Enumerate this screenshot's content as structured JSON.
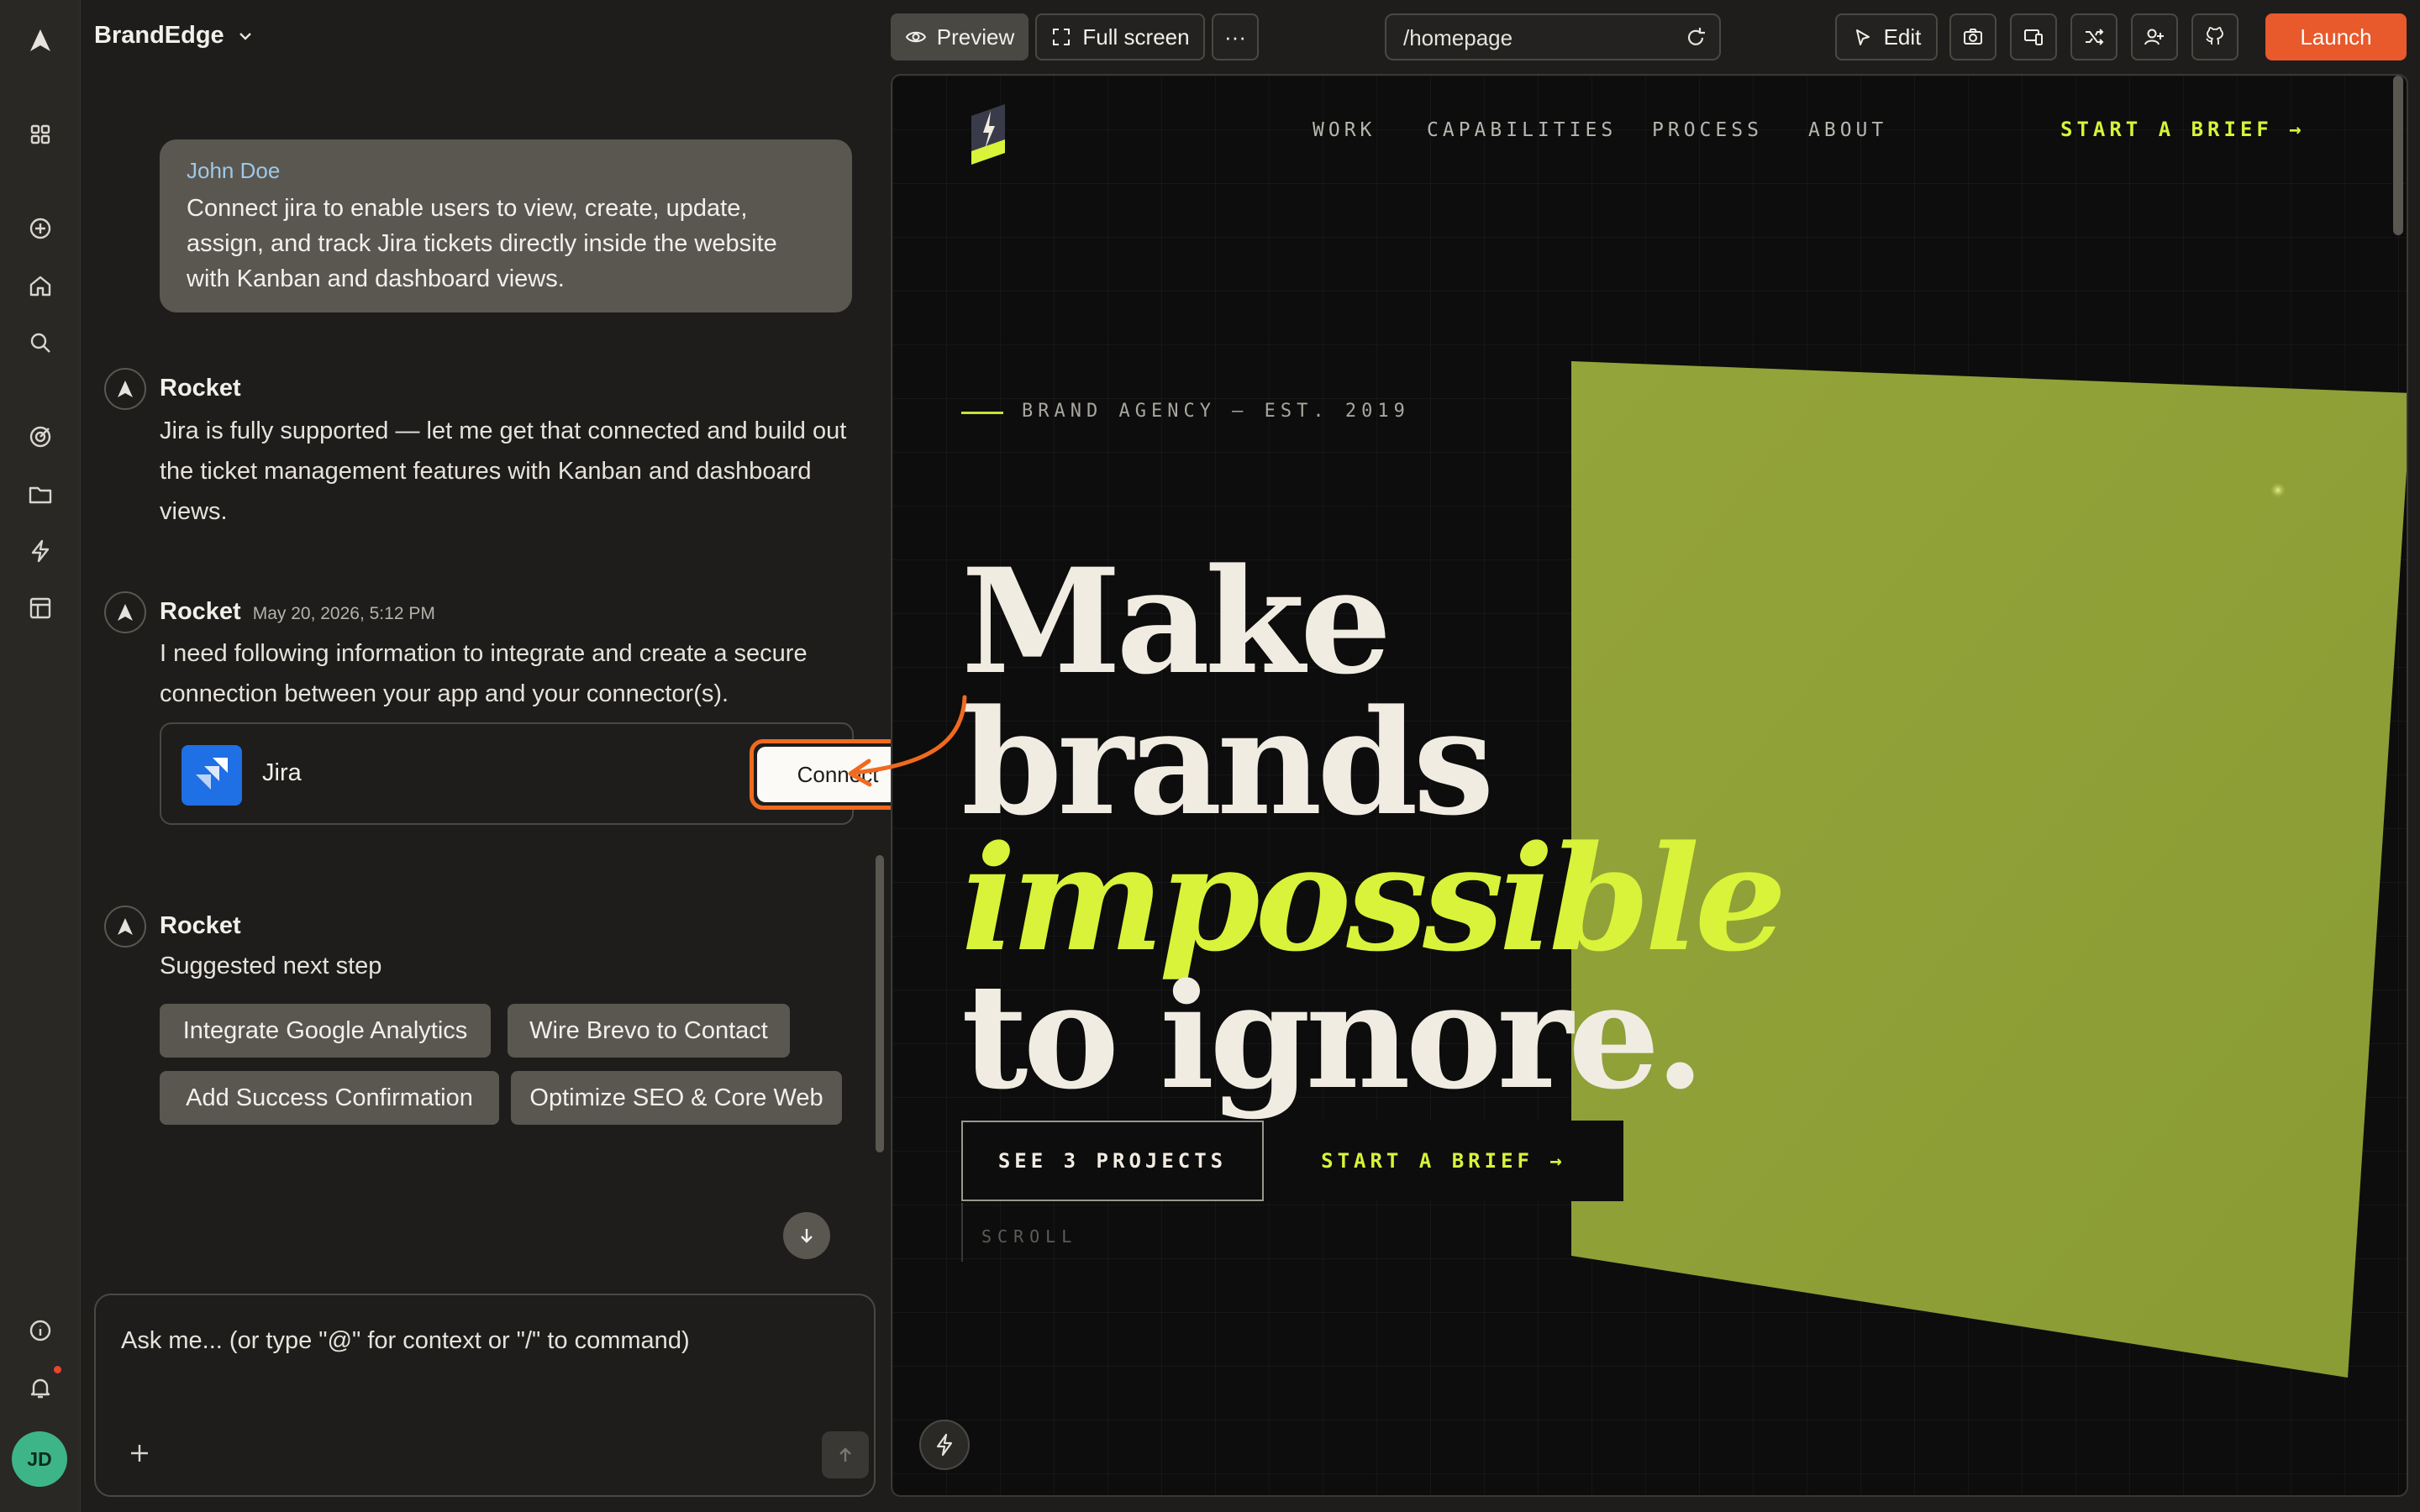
{
  "app": {
    "project_name": "BrandEdge"
  },
  "rail": {
    "items": [
      "apps-icon",
      "new-icon",
      "home-icon",
      "search-icon",
      "target-icon",
      "folder-icon",
      "bolt-icon",
      "layout-icon"
    ],
    "bottom": [
      "info-icon",
      "bell-icon"
    ],
    "avatar_initials": "JD"
  },
  "chat": {
    "user_message": {
      "author": "John Doe",
      "text": "Connect jira to enable users to view, create, update, assign, and track Jira tickets directly inside the website with Kanban and dashboard views."
    },
    "messages": [
      {
        "author": "Rocket",
        "time": "",
        "text": "Jira is fully supported — let me get that connected and build out the ticket management features with Kanban and dashboard views."
      },
      {
        "author": "Rocket",
        "time": "May 20, 2026, 5:12 PM",
        "text": "I need following information to integrate and create a secure connection between your app and your connector(s)."
      },
      {
        "author": "Rocket",
        "time": "",
        "text": "Suggested next step"
      }
    ],
    "connector": {
      "name": "Jira",
      "button_label": "Connect"
    },
    "suggestions": [
      "Integrate Google Analytics",
      "Wire Brevo to Contact",
      "Add Success Confirmation",
      "Optimize SEO & Core Web"
    ],
    "composer_placeholder": "Ask me... (or type \"@\" for context or \"/\" to command)"
  },
  "toolbar": {
    "preview_label": "Preview",
    "fullscreen_label": "Full screen",
    "more_label": "···",
    "url": "/homepage",
    "edit_label": "Edit",
    "launch_label": "Launch",
    "accent": "#e8592b"
  },
  "site": {
    "nav": [
      "WORK",
      "CAPABILITIES",
      "PROCESS",
      "ABOUT"
    ],
    "nav_cta": "START A BRIEF →",
    "eyebrow": "BRAND AGENCY — EST. 2019",
    "headline": [
      "Make",
      "brands",
      "impossible",
      "to ignore."
    ],
    "primary_cta": "SEE 3 PROJECTS",
    "secondary_cta": "START A BRIEF →",
    "scroll_label": "SCROLL",
    "accent": "#d8f33a"
  }
}
